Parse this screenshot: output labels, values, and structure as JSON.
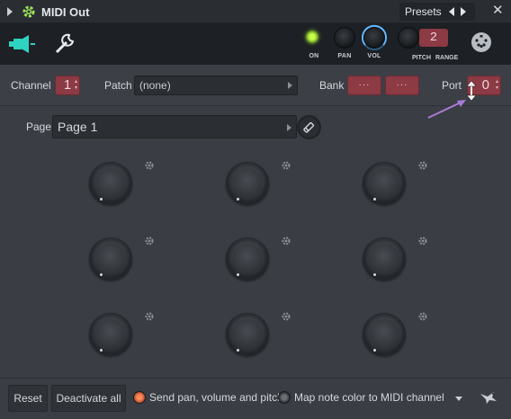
{
  "window": {
    "title": "MIDI Out",
    "presets_label": "Presets",
    "close_glyph": "✕"
  },
  "toolbar": {
    "knobs": [
      {
        "label": "ON",
        "type": "led"
      },
      {
        "label": "PAN",
        "type": "knob"
      },
      {
        "label": "VOL",
        "type": "knob"
      },
      {
        "label": "PITCH",
        "type": "knob"
      }
    ],
    "range_value": "2",
    "range_label": "RANGE"
  },
  "settings": {
    "channel_label": "Channel",
    "channel_value": "1",
    "patch_label": "Patch",
    "patch_value": "(none)",
    "bank_label": "Bank",
    "bank_value_1": "···",
    "bank_value_2": "···",
    "port_label": "Port",
    "port_value": "0"
  },
  "page": {
    "label": "Page",
    "value": "Page 1"
  },
  "knob_grid": {
    "rows": 3,
    "cols": 3
  },
  "bottom": {
    "reset_label": "Reset",
    "deactivate_label": "Deactivate all",
    "option1_label": "Send pan, volume and pitch",
    "option1_checked": true,
    "option2_label": "Map note color to MIDI channel",
    "option2_checked": false
  },
  "colors": {
    "accent_red": "#8c3a44",
    "led_green": "#a6e035",
    "radio_orange": "#ff8a5c",
    "annotation_arrow": "#a77bd6"
  }
}
